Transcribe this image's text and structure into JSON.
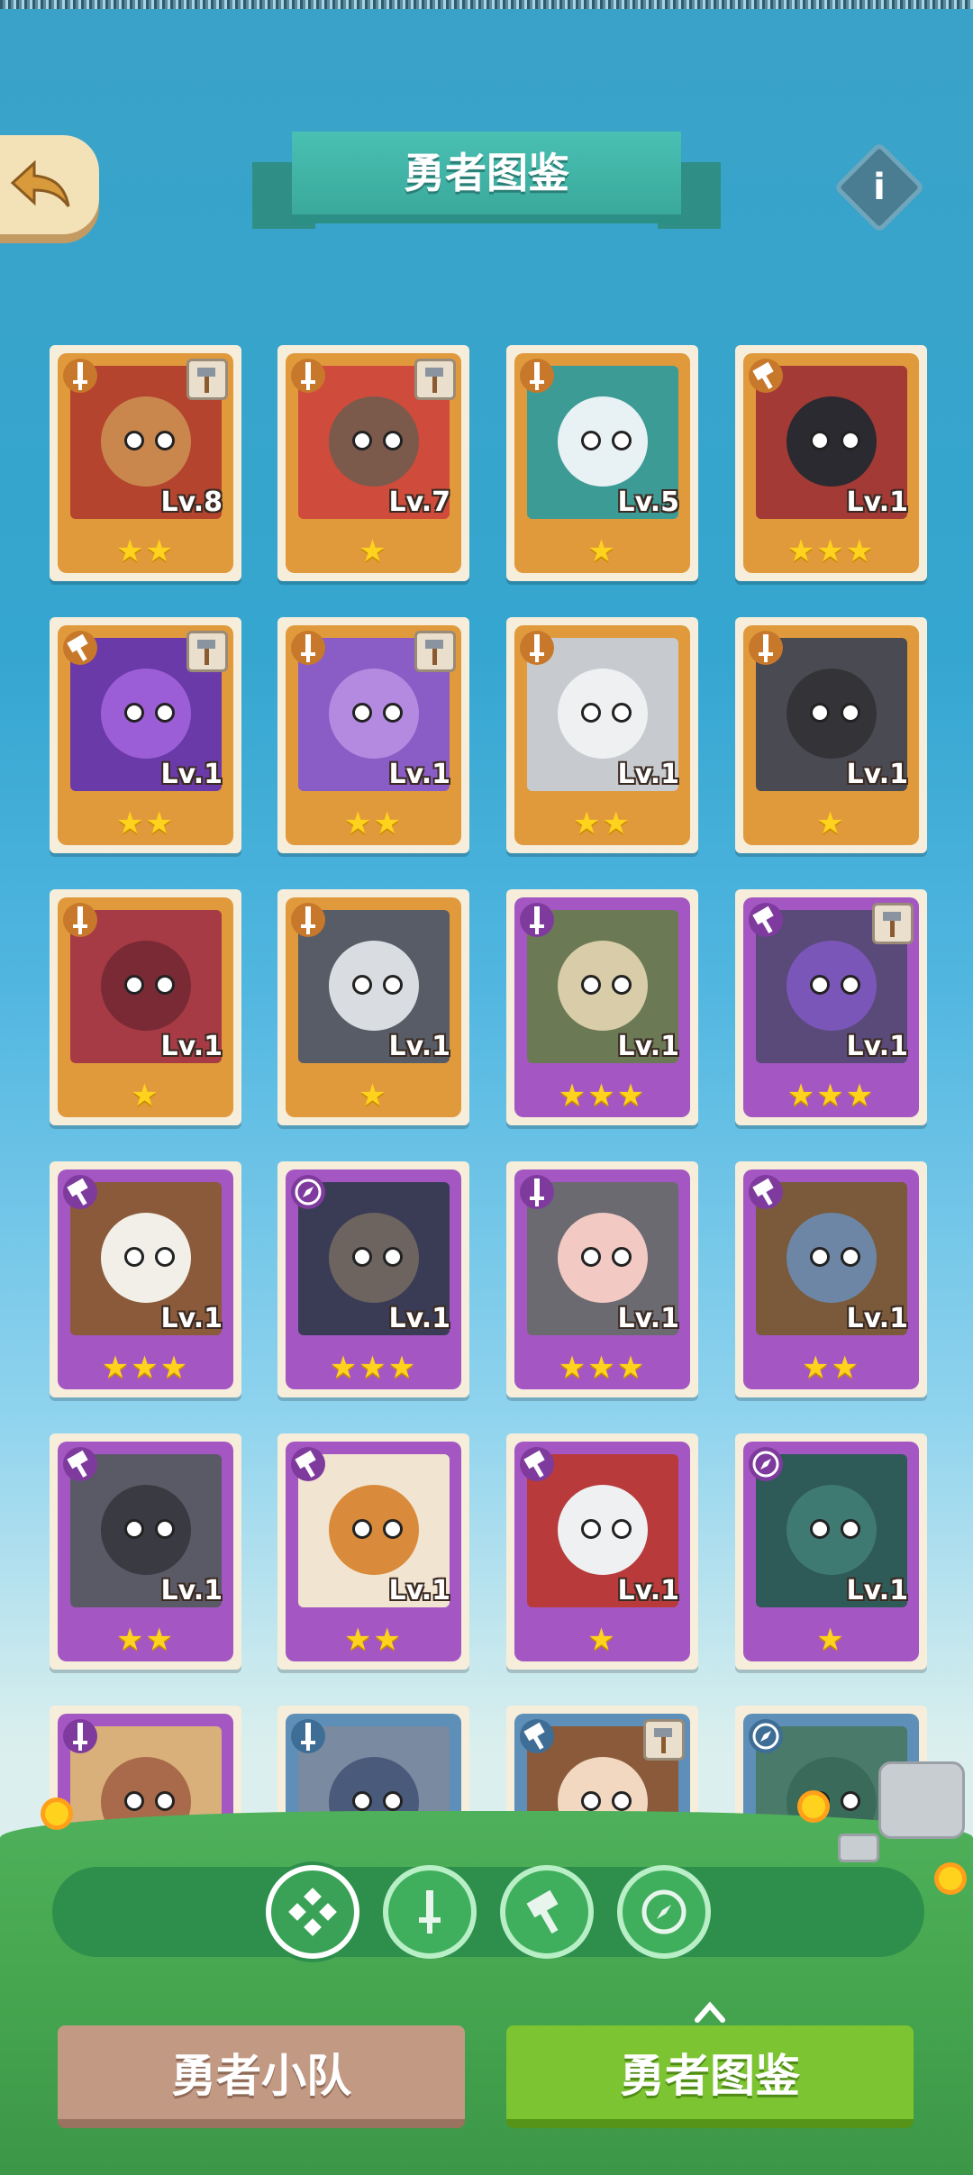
{
  "header": {
    "title": "勇者图鉴",
    "info_label": "i"
  },
  "colors": {
    "orange": "#e09a3c",
    "purple": "#a457c2",
    "blue": "#5d8fb8",
    "star": "#ffd21e"
  },
  "heroes": [
    {
      "frame": "orange",
      "class": "sword",
      "weapon": true,
      "level": "Lv.8",
      "stars": 2,
      "face": "#c9874e",
      "bg": "#b5442f",
      "name_icon": "monkey-icon"
    },
    {
      "frame": "orange",
      "class": "sword",
      "weapon": true,
      "level": "Lv.7",
      "stars": 1,
      "face": "#7b5a4c",
      "bg": "#cf4b3b",
      "name_icon": "bull-icon"
    },
    {
      "frame": "orange",
      "class": "sword",
      "weapon": false,
      "level": "Lv.5",
      "stars": 1,
      "face": "#e8f1f4",
      "bg": "#3d9b96",
      "name_icon": "polar-bear-icon"
    },
    {
      "frame": "orange",
      "class": "hammer",
      "weapon": false,
      "level": "Lv.1",
      "stars": 3,
      "face": "#2a2a30",
      "bg": "#a33a35",
      "name_icon": "wolf-icon"
    },
    {
      "frame": "orange",
      "class": "hammer",
      "weapon": true,
      "level": "Lv.1",
      "stars": 2,
      "face": "#9c5ed6",
      "bg": "#6a3aa8",
      "name_icon": "octopus-icon"
    },
    {
      "frame": "orange",
      "class": "sword",
      "weapon": true,
      "level": "Lv.1",
      "stars": 2,
      "face": "#b48ae0",
      "bg": "#8a5cc6",
      "name_icon": "elephant-icon"
    },
    {
      "frame": "orange",
      "class": "sword",
      "weapon": false,
      "level": "Lv.1",
      "stars": 2,
      "face": "#eef0f2",
      "bg": "#c7cbd0",
      "name_icon": "white-wolf-icon"
    },
    {
      "frame": "orange",
      "class": "sword",
      "weapon": false,
      "level": "Lv.1",
      "stars": 1,
      "face": "#333338",
      "bg": "#4a4a52",
      "name_icon": "black-goat-icon"
    },
    {
      "frame": "orange",
      "class": "sword",
      "weapon": false,
      "level": "Lv.1",
      "stars": 1,
      "face": "#7a2a35",
      "bg": "#a63b46",
      "name_icon": "dragon-icon"
    },
    {
      "frame": "orange",
      "class": "sword",
      "weapon": false,
      "level": "Lv.1",
      "stars": 1,
      "face": "#d9dde2",
      "bg": "#575c66",
      "name_icon": "husky-icon"
    },
    {
      "frame": "purple",
      "class": "sword",
      "weapon": false,
      "level": "Lv.1",
      "stars": 3,
      "face": "#d8cda8",
      "bg": "#6b7a55",
      "name_icon": "lion-icon"
    },
    {
      "frame": "purple",
      "class": "hammer",
      "weapon": true,
      "level": "Lv.1",
      "stars": 3,
      "face": "#7a56b8",
      "bg": "#5a4a7a",
      "name_icon": "rhino-icon"
    },
    {
      "frame": "purple",
      "class": "hammer",
      "weapon": false,
      "level": "Lv.1",
      "stars": 3,
      "face": "#f2efe8",
      "bg": "#8a5a3a",
      "name_icon": "eagle-icon"
    },
    {
      "frame": "purple",
      "class": "ranger",
      "weapon": false,
      "level": "Lv.1",
      "stars": 3,
      "face": "#6d6460",
      "bg": "#3a3c55",
      "name_icon": "shark-ninja-icon"
    },
    {
      "frame": "purple",
      "class": "sword",
      "weapon": false,
      "level": "Lv.1",
      "stars": 3,
      "face": "#f3c9c4",
      "bg": "#6a6a70",
      "name_icon": "sheep-nun-icon"
    },
    {
      "frame": "purple",
      "class": "hammer",
      "weapon": false,
      "level": "Lv.1",
      "stars": 2,
      "face": "#6d86a6",
      "bg": "#7a5a3a",
      "name_icon": "boar-icon"
    },
    {
      "frame": "purple",
      "class": "hammer",
      "weapon": false,
      "level": "Lv.1",
      "stars": 2,
      "face": "#3a3a42",
      "bg": "#5a5a66",
      "name_icon": "black-cat-icon"
    },
    {
      "frame": "purple",
      "class": "hammer",
      "weapon": false,
      "level": "Lv.1",
      "stars": 2,
      "face": "#d98a3a",
      "bg": "#f1e4d0",
      "name_icon": "pangolin-icon"
    },
    {
      "frame": "purple",
      "class": "hammer",
      "weapon": false,
      "level": "Lv.1",
      "stars": 1,
      "face": "#eef0f2",
      "bg": "#b83a3a",
      "name_icon": "white-fox-icon"
    },
    {
      "frame": "purple",
      "class": "ranger",
      "weapon": false,
      "level": "Lv.1",
      "stars": 1,
      "face": "#3f7a72",
      "bg": "#2e5a57",
      "name_icon": "duck-soldiers-icon"
    },
    {
      "frame": "purple",
      "class": "sword",
      "weapon": false,
      "level": "",
      "stars": 0,
      "face": "#a86a4a",
      "bg": "#d9b07a",
      "name_icon": "lizard-icon"
    },
    {
      "frame": "blue",
      "class": "sword",
      "weapon": false,
      "level": "",
      "stars": 0,
      "face": "#4a5a7a",
      "bg": "#7a8aa0",
      "name_icon": "knight-icon"
    },
    {
      "frame": "blue",
      "class": "hammer",
      "weapon": true,
      "level": "",
      "stars": 0,
      "face": "#f2d8c0",
      "bg": "#8a5a3a",
      "name_icon": "girl-icon"
    },
    {
      "frame": "blue",
      "class": "ranger",
      "weapon": false,
      "level": "",
      "stars": 0,
      "face": "#3a6a5a",
      "bg": "#4a7a6a",
      "name_icon": "frog-icon"
    }
  ],
  "filters": [
    {
      "name": "all",
      "active": true
    },
    {
      "name": "sword",
      "active": false
    },
    {
      "name": "hammer",
      "active": false
    },
    {
      "name": "ranger",
      "active": false
    }
  ],
  "tabs": {
    "team": "勇者小队",
    "codex": "勇者图鉴"
  }
}
